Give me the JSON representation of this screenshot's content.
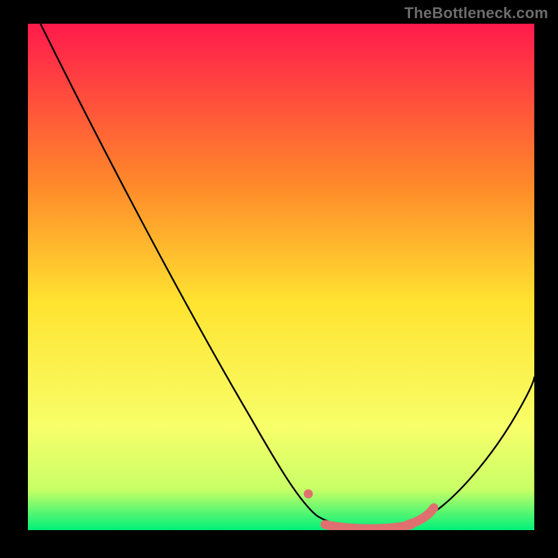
{
  "watermark": "TheBottleneck.com",
  "colors": {
    "frame": "#000000",
    "gradient_top": "#ff1a4c",
    "gradient_mid1": "#ff8a2a",
    "gradient_mid2": "#ffe330",
    "gradient_mid3": "#f7ff6a",
    "gradient_bottom": "#00f07a",
    "curve": "#000000",
    "highlight": "#e06f6f"
  },
  "chart_data": {
    "type": "line",
    "title": "",
    "xlabel": "",
    "ylabel": "",
    "xlim": [
      0,
      100
    ],
    "ylim": [
      0,
      100
    ],
    "x": [
      0,
      4,
      8,
      12,
      16,
      20,
      24,
      28,
      32,
      36,
      40,
      44,
      48,
      52,
      55,
      58,
      61,
      64,
      67,
      70,
      73,
      76,
      80,
      84,
      88,
      92,
      96,
      100
    ],
    "y": [
      100,
      93,
      86,
      79,
      72,
      65,
      58,
      51,
      44,
      37,
      30,
      23,
      17,
      11,
      6,
      3,
      1,
      0,
      0,
      0,
      0.5,
      2,
      5,
      10,
      17,
      25,
      34,
      44
    ],
    "highlight_segments": [
      {
        "type": "dot",
        "x": 53.5,
        "y": 8.5
      },
      {
        "type": "line",
        "x_range": [
          58,
          70
        ],
        "y": 0.5
      },
      {
        "type": "line",
        "x_range": [
          68,
          74
        ],
        "y_range": [
          0.5,
          3.5
        ]
      }
    ],
    "notes": "V-shaped bottleneck curve on a vertical heat gradient (red=bad at top to green=good at bottom). Black curve descends steeply from top-left, bottoms out ~x=62–72, then rises toward the right. Salmon-pink highlight marks the floor region."
  }
}
